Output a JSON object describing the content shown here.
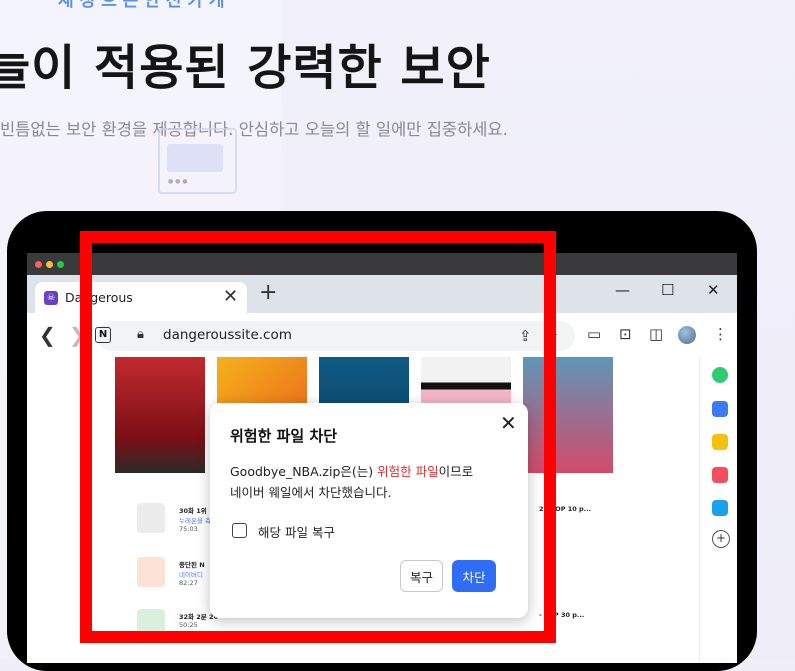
{
  "hero": {
    "top_sub": "재 정 으 은 안 전 카 게",
    "headline": "늘이 적용된 강력한 보안",
    "subtitle": "빈틈없는 보안 환경을 제공합니다. 안심하고 오늘의 할 일에만 집중하세요."
  },
  "browser": {
    "tab_title": "Dangerous",
    "url": "dangeroussite.com",
    "icons": [
      "close-icon",
      "plus-icon",
      "minimize-icon",
      "maximize-icon",
      "back-icon",
      "forward-icon",
      "lock-icon",
      "share-icon",
      "bookmark-icon",
      "camera-icon",
      "screenshot-icon",
      "split-icon",
      "avatar",
      "more-icon"
    ]
  },
  "mail_list": {
    "rows": [
      {
        "title": "30화 1위",
        "sub": "누레온을 축",
        "meta": "75:03"
      },
      {
        "title": "중단된 N",
        "sub": "네이버디",
        "meta": "82:27"
      },
      {
        "title": "32화 2분 20",
        "sub": "",
        "meta": "50:25"
      }
    ],
    "right_rows": [
      "2 - TOP 10 p...",
      "- TOP 30 p..."
    ]
  },
  "dialog": {
    "title": "위험한 파일 차단",
    "msg_part1": "Goodbye_NBA.zip은(는) ",
    "msg_danger": "위험한 파일",
    "msg_part2": "이므로",
    "msg_line2": "네이버 웨일에서 차단했습니다.",
    "checkbox_label": "해당 파일 복구",
    "restore_label": "복구",
    "block_label": "차단"
  },
  "colors": {
    "accent": "#2f6df6",
    "danger_text": "#e03030",
    "highlight_frame": "#ff0000"
  }
}
